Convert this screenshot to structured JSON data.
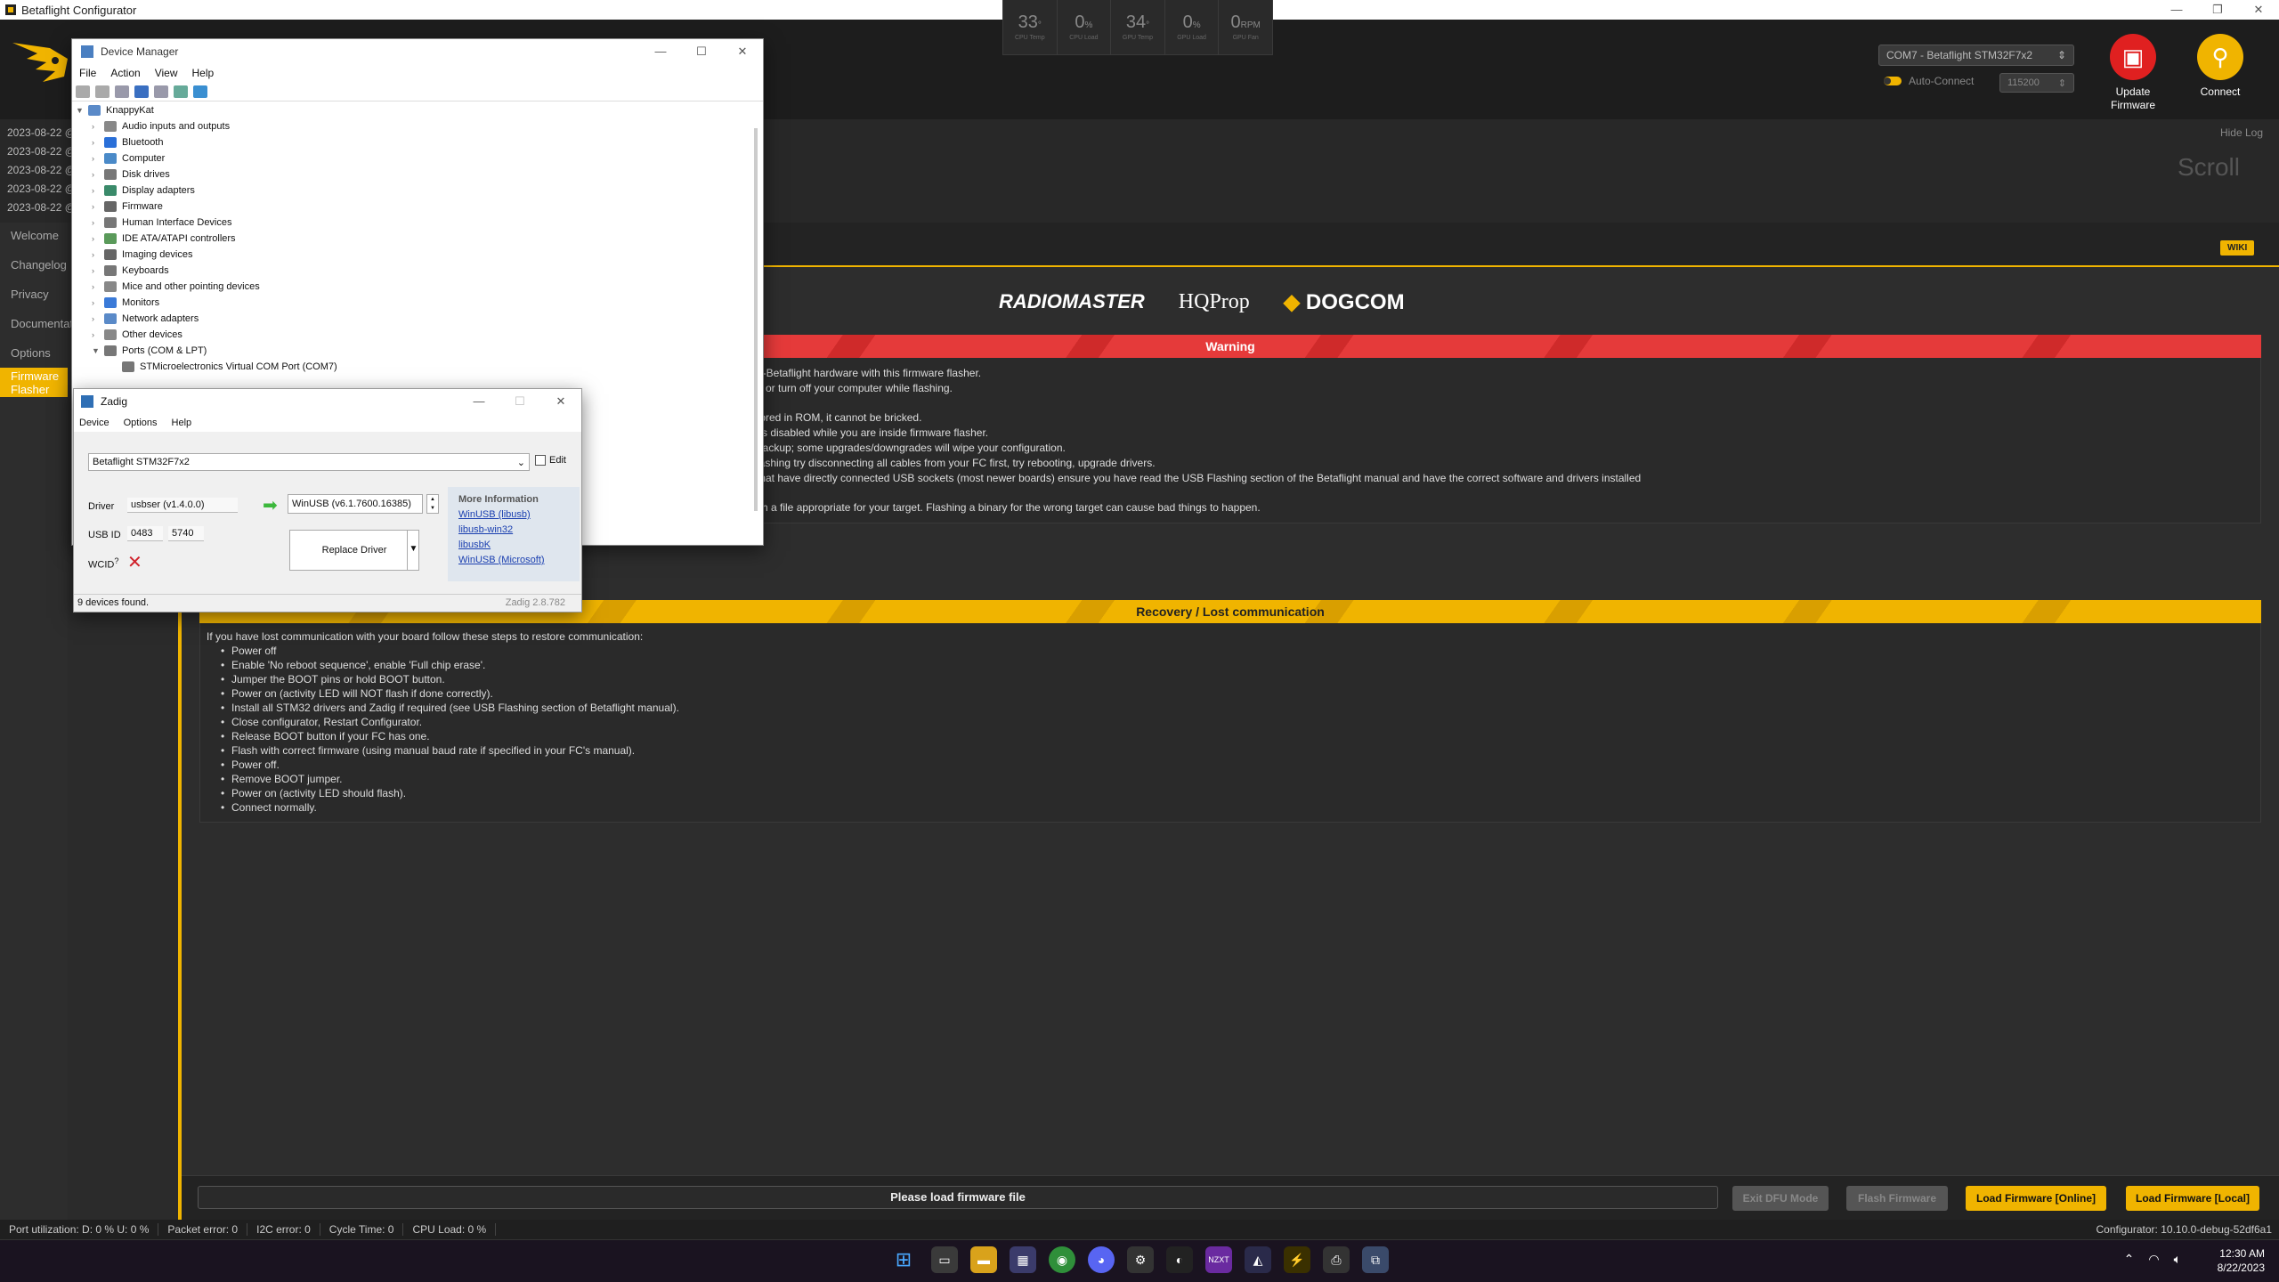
{
  "window": {
    "title": "Betaflight Configurator"
  },
  "sensors": [
    {
      "value": "33",
      "unit": "°",
      "label": "CPU Temp"
    },
    {
      "value": "0",
      "unit": "%",
      "label": "CPU Load"
    },
    {
      "value": "34",
      "unit": "°",
      "label": "GPU Temp"
    },
    {
      "value": "0",
      "unit": "%",
      "label": "GPU Load"
    },
    {
      "value": "0",
      "unit": "RPM",
      "label": "GPU Fan"
    }
  ],
  "header": {
    "port": "COM7 - Betaflight STM32F7x2",
    "auto_connect": "Auto-Connect",
    "baud": "115200",
    "update_firmware": "Update\nFirmware",
    "connect": "Connect"
  },
  "log": {
    "lines": [
      "2023-08-22 @",
      "2023-08-22 @",
      "2023-08-22 @",
      "2023-08-22 @",
      "2023-08-22 @"
    ],
    "hide_log": "Hide Log",
    "scroll": "Scroll"
  },
  "nav": [
    "Welcome",
    "Changelog",
    "Privacy",
    "Documentation",
    "Options",
    "Firmware Flasher"
  ],
  "content": {
    "wiki": "WIKI",
    "sponsors": [
      "RADIOMASTER",
      "HQProp",
      "DOGCOM"
    ],
    "warning_title": "Warning",
    "warning_lines": [
      "n-Betaflight hardware with this firmware flasher.",
      "d or turn off your computer while flashing.",
      "",
      "tored in ROM, it cannot be bricked.",
      "ys disabled while you are inside firmware flasher.",
      "backup; some upgrades/downgrades will wipe your configuration.",
      "lashing try disconnecting all cables from your FC first, try rebooting, upgrade drivers.",
      "that have directly connected USB sockets (most newer boards) ensure you have read the USB Flashing section of the Betaflight manual and have the correct software and drivers installed",
      "",
      "sh a file appropriate for your target. Flashing a binary for the wrong target can cause bad things to happen."
    ],
    "recovery_title": "Recovery / Lost communication",
    "recovery_intro": "If you have lost communication with your board follow these steps to restore communication:",
    "recovery_steps": [
      "Power off",
      "Enable 'No reboot sequence', enable 'Full chip erase'.",
      "Jumper the BOOT pins or hold BOOT button.",
      "Power on (activity LED will NOT flash if done correctly).",
      "Install all STM32 drivers and Zadig if required (see USB Flashing section of Betaflight manual).",
      "Close configurator, Restart Configurator.",
      "Release BOOT button if your FC has one.",
      "Flash with correct firmware (using manual baud rate if specified in your FC's manual).",
      "Power off.",
      "Remove BOOT jumper.",
      "Power on (activity LED should flash).",
      "Connect normally."
    ]
  },
  "toolbar": {
    "progress": "Please load firmware file",
    "exit_dfu": "Exit DFU Mode",
    "flash": "Flash Firmware",
    "load_online": "Load Firmware [Online]",
    "load_local": "Load Firmware [Local]"
  },
  "status": {
    "port_util": "Port utilization: D: 0 % U: 0 %",
    "packet_error": "Packet error: 0",
    "i2c_error": "I2C error: 0",
    "cycle_time": "Cycle Time: 0",
    "cpu_load": "CPU Load: 0 %",
    "version": "Configurator: 10.10.0-debug-52df6a1"
  },
  "taskbar": {
    "time": "12:30 AM",
    "date": "8/22/2023"
  },
  "device_manager": {
    "title": "Device Manager",
    "menu": [
      "File",
      "Action",
      "View",
      "Help"
    ],
    "root": "KnappyKat",
    "nodes": [
      "Audio inputs and outputs",
      "Bluetooth",
      "Computer",
      "Disk drives",
      "Display adapters",
      "Firmware",
      "Human Interface Devices",
      "IDE ATA/ATAPI controllers",
      "Imaging devices",
      "Keyboards",
      "Mice and other pointing devices",
      "Monitors",
      "Network adapters",
      "Other devices",
      "Ports (COM & LPT)"
    ],
    "child": "STMicroelectronics Virtual COM Port (COM7)"
  },
  "zadig": {
    "title": "Zadig",
    "menu": [
      "Device",
      "Options",
      "Help"
    ],
    "device": "Betaflight STM32F7x2",
    "edit": "Edit",
    "driver_label": "Driver",
    "driver": "usbser (v1.4.0.0)",
    "target": "WinUSB (v6.1.7600.16385)",
    "usbid_label": "USB ID",
    "vid": "0483",
    "pid": "5740",
    "wcid_label": "WCID",
    "replace": "Replace Driver",
    "more_info": "More Information",
    "links": [
      "WinUSB (libusb)",
      "libusb-win32",
      "libusbK",
      "WinUSB (Microsoft)"
    ],
    "status": "9 devices found.",
    "version": "Zadig 2.8.782"
  }
}
